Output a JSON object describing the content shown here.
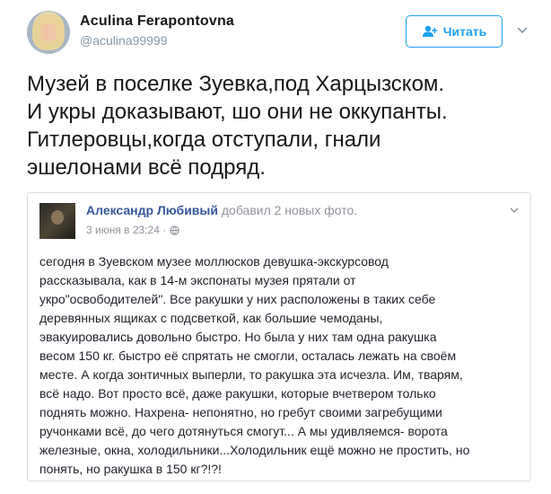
{
  "user": {
    "display_name": "Aculina Ferapontovna",
    "handle": "@aculina99999"
  },
  "follow_button": {
    "label": "Читать"
  },
  "tweet": {
    "text": "Музей в поселке Зуевка,под Харцызском.\nИ укры доказывают, шо они не оккупанты.\nГитлеровцы,когда отступали, гнали\nэшелонами всё подряд."
  },
  "quote": {
    "author": "Александр Любивый",
    "action": "добавил 2 новых фото.",
    "timestamp": "3 июня в 23:24 ·",
    "text": "сегодня в Зуевском музее моллюсков девушка-экскурсовод\nрассказывала, как в 14-м экспонаты музея прятали от\nукро\"освободителей\". Все ракушки у них расположены в таких себе\nдеревянных ящиках с подсветкой, как большие чемоданы,\nэвакуировались довольно быстро. Но была у них там одна ракушка\nвесом 150 кг. быстро её спрятать не смогли, осталась лежать на своём\nместе. А когда зонтичных выперли, то ракушка эта исчезла. Им, тварям,\nвсё надо. Вот просто всё, даже ракушки, которые вчетвером только\nподнять можно. Нахрена- непонятно, но гребут своими загребущими\nручонками всё, до чего дотянуться смогут... А мы удивляемся- ворота\nжелезные, окна, холодильники...Холодильник ещё можно не простить, но\nпонять, но ракушка в 150 кг?!?!"
  },
  "colors": {
    "accent": "#1da1f2",
    "fb_link": "#365899",
    "muted": "#8899a6"
  },
  "icons": {
    "follow": "add-user-icon",
    "caret": "chevron-down-icon",
    "globe": "globe-icon"
  }
}
